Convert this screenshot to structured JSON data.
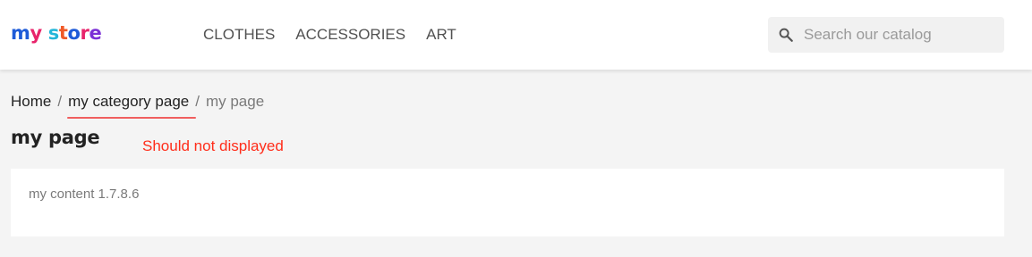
{
  "header": {
    "logo": {
      "letters": [
        {
          "char": "m",
          "color": "#1e5bd8"
        },
        {
          "char": "y",
          "color": "#e8246b"
        },
        {
          "char": " ",
          "color": "#000000"
        },
        {
          "char": "s",
          "color": "#24b6d9"
        },
        {
          "char": "t",
          "color": "#f05a28"
        },
        {
          "char": "o",
          "color": "#1e5bd8"
        },
        {
          "char": "r",
          "color": "#e8246b"
        },
        {
          "char": "e",
          "color": "#7b2fd6"
        }
      ]
    },
    "menu": [
      {
        "label": "CLOTHES"
      },
      {
        "label": "ACCESSORIES"
      },
      {
        "label": "ART"
      }
    ],
    "search": {
      "placeholder": "Search our catalog",
      "icon": "search-icon",
      "value": ""
    }
  },
  "breadcrumb": {
    "items": [
      {
        "label": "Home"
      },
      {
        "label": "my category page"
      }
    ],
    "separator": "/",
    "current": "my page"
  },
  "page": {
    "title": "my page",
    "annotation": "Should not displayed",
    "content": "my content 1.7.8.6"
  },
  "colors": {
    "annotation": "#ff2d1a",
    "background": "#f4f4f4"
  }
}
